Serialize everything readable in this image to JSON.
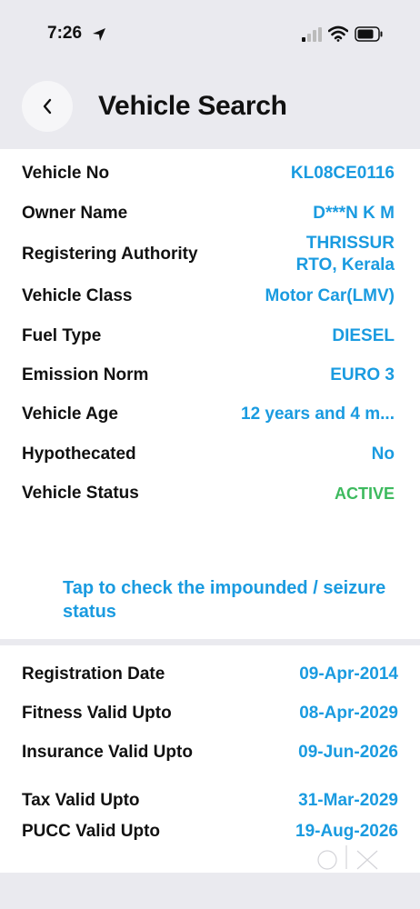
{
  "status_bar": {
    "time": "7:26"
  },
  "header": {
    "title": "Vehicle Search"
  },
  "vehicle": [
    {
      "label": "Vehicle No",
      "value": "KL08CE0116"
    },
    {
      "label": "Owner Name",
      "value": "D***N K M"
    },
    {
      "label": "Registering Authority",
      "value": "THRISSUR RTO, Kerala"
    },
    {
      "label": "Vehicle Class",
      "value": "Motor Car(LMV)"
    },
    {
      "label": "Fuel Type",
      "value": "DIESEL"
    },
    {
      "label": "Emission Norm",
      "value": "EURO 3"
    },
    {
      "label": "Vehicle Age",
      "value": "12 years and 4 m..."
    },
    {
      "label": "Hypothecated",
      "value": "No"
    },
    {
      "label": "Vehicle Status",
      "value": "ACTIVE"
    }
  ],
  "impound_link": "Tap to check the impounded / seizure status",
  "validity": [
    {
      "label": "Registration Date",
      "value": "09-Apr-2014"
    },
    {
      "label": "Fitness Valid Upto",
      "value": "08-Apr-2029"
    },
    {
      "label": "Insurance Valid Upto",
      "value": "09-Jun-2026"
    },
    {
      "label": "Tax Valid Upto",
      "value": "31-Mar-2029"
    },
    {
      "label": "PUCC Valid Upto",
      "value": "19-Aug-2026"
    }
  ],
  "colors": {
    "accent": "#1a9be0",
    "active": "#3dba5e",
    "background": "#eaeaef"
  },
  "icons": {
    "back": "chevron-left-icon",
    "location": "location-arrow-icon",
    "signal": "cell-signal-icon",
    "wifi": "wifi-icon",
    "battery": "battery-icon",
    "watermark": "olx-logo"
  }
}
